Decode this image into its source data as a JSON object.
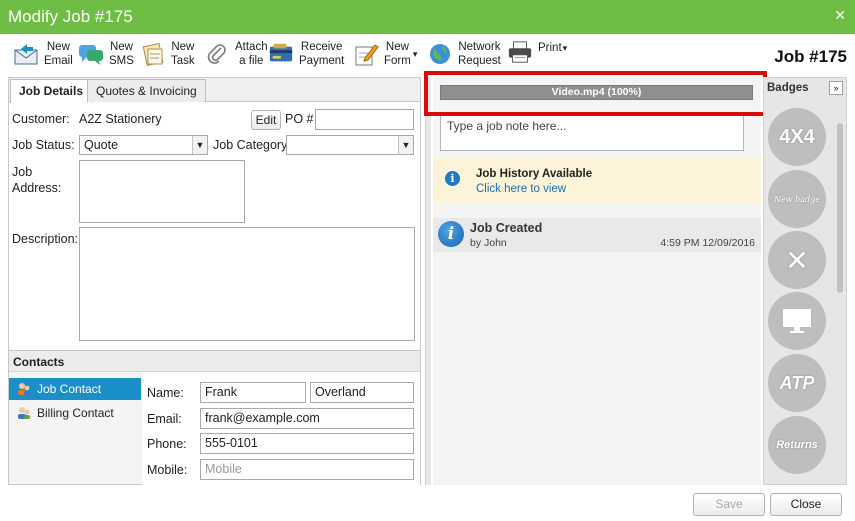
{
  "window": {
    "title": "Modify Job #175",
    "close_glyph": "✕"
  },
  "toolbar": {
    "items": [
      {
        "label": "New\nEmail",
        "icon": "email-icon"
      },
      {
        "label": "New\nSMS",
        "icon": "sms-icon"
      },
      {
        "label": "New\nTask",
        "icon": "task-icon"
      },
      {
        "label": "Attach\na file",
        "icon": "paperclip-icon"
      },
      {
        "label": "Receive\nPayment",
        "icon": "payment-icon"
      },
      {
        "label": "New\nForm",
        "icon": "form-icon"
      },
      {
        "label": "Network\nRequest",
        "icon": "globe-icon"
      },
      {
        "label": "Print",
        "icon": "printer-icon"
      }
    ],
    "dropdown_glyph": "▾",
    "job_title": "Job #175"
  },
  "tabs": [
    "Job Details",
    "Quotes & Invoicing"
  ],
  "job_details": {
    "customer_label": "Customer:",
    "customer_value": "A2Z Stationery",
    "edit_button": "Edit",
    "po_label": "PO #",
    "po_value": "",
    "status_label": "Job Status:",
    "status_value": "Quote",
    "category_label": "Job Category",
    "category_value": "",
    "address_label": "Job\nAddress:",
    "description_label": "Description:"
  },
  "contacts": {
    "header": "Contacts",
    "items": [
      "Job Contact",
      "Billing Contact"
    ],
    "name_label": "Name:",
    "first_name": "Frank",
    "last_name": "Overland",
    "email_label": "Email:",
    "email": "frank@example.com",
    "phone_label": "Phone:",
    "phone": "555-0101",
    "mobile_label": "Mobile:",
    "mobile_placeholder": "Mobile"
  },
  "notes": {
    "upload_progress_text": "Video.mp4 (100%)",
    "upload_progress": 1.0,
    "note_placeholder": "Type a job note here...",
    "history_title": "Job History Available",
    "history_link": "Click here to view",
    "events": [
      {
        "title": "Job Created",
        "by": "by John",
        "time": "4:59 PM 12/09/2016"
      }
    ]
  },
  "badges": {
    "header": "Badges",
    "expand_glyph": "»",
    "items": [
      "4X4",
      "New badge",
      "✕",
      "",
      "ATP",
      "Returns"
    ]
  },
  "footer": {
    "save": "Save",
    "close": "Close"
  },
  "colors": {
    "titlebar": "#6ebd44",
    "highlight": "#d60d0d",
    "active_contact": "#1a8fc8"
  }
}
